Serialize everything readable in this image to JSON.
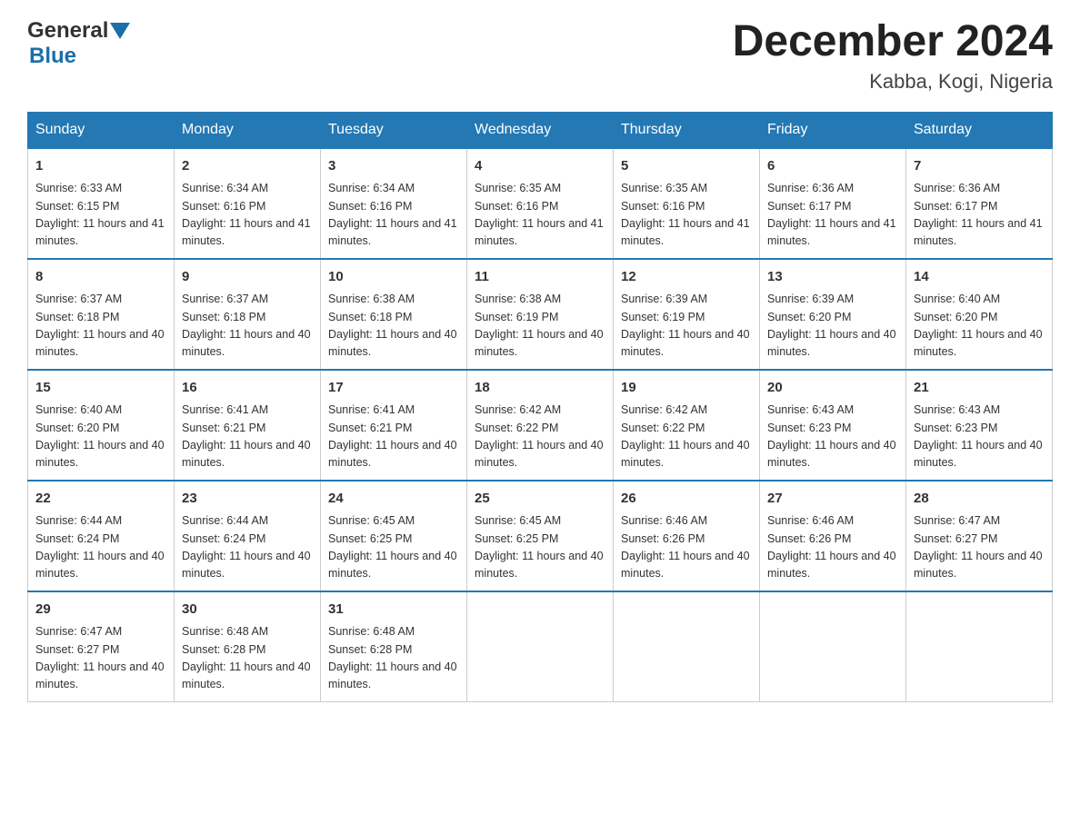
{
  "header": {
    "logo_general": "General",
    "logo_blue": "Blue",
    "title": "December 2024",
    "subtitle": "Kabba, Kogi, Nigeria"
  },
  "columns": [
    "Sunday",
    "Monday",
    "Tuesday",
    "Wednesday",
    "Thursday",
    "Friday",
    "Saturday"
  ],
  "weeks": [
    [
      {
        "day": "1",
        "sunrise": "6:33 AM",
        "sunset": "6:15 PM",
        "daylight": "11 hours and 41 minutes."
      },
      {
        "day": "2",
        "sunrise": "6:34 AM",
        "sunset": "6:16 PM",
        "daylight": "11 hours and 41 minutes."
      },
      {
        "day": "3",
        "sunrise": "6:34 AM",
        "sunset": "6:16 PM",
        "daylight": "11 hours and 41 minutes."
      },
      {
        "day": "4",
        "sunrise": "6:35 AM",
        "sunset": "6:16 PM",
        "daylight": "11 hours and 41 minutes."
      },
      {
        "day": "5",
        "sunrise": "6:35 AM",
        "sunset": "6:16 PM",
        "daylight": "11 hours and 41 minutes."
      },
      {
        "day": "6",
        "sunrise": "6:36 AM",
        "sunset": "6:17 PM",
        "daylight": "11 hours and 41 minutes."
      },
      {
        "day": "7",
        "sunrise": "6:36 AM",
        "sunset": "6:17 PM",
        "daylight": "11 hours and 41 minutes."
      }
    ],
    [
      {
        "day": "8",
        "sunrise": "6:37 AM",
        "sunset": "6:18 PM",
        "daylight": "11 hours and 40 minutes."
      },
      {
        "day": "9",
        "sunrise": "6:37 AM",
        "sunset": "6:18 PM",
        "daylight": "11 hours and 40 minutes."
      },
      {
        "day": "10",
        "sunrise": "6:38 AM",
        "sunset": "6:18 PM",
        "daylight": "11 hours and 40 minutes."
      },
      {
        "day": "11",
        "sunrise": "6:38 AM",
        "sunset": "6:19 PM",
        "daylight": "11 hours and 40 minutes."
      },
      {
        "day": "12",
        "sunrise": "6:39 AM",
        "sunset": "6:19 PM",
        "daylight": "11 hours and 40 minutes."
      },
      {
        "day": "13",
        "sunrise": "6:39 AM",
        "sunset": "6:20 PM",
        "daylight": "11 hours and 40 minutes."
      },
      {
        "day": "14",
        "sunrise": "6:40 AM",
        "sunset": "6:20 PM",
        "daylight": "11 hours and 40 minutes."
      }
    ],
    [
      {
        "day": "15",
        "sunrise": "6:40 AM",
        "sunset": "6:20 PM",
        "daylight": "11 hours and 40 minutes."
      },
      {
        "day": "16",
        "sunrise": "6:41 AM",
        "sunset": "6:21 PM",
        "daylight": "11 hours and 40 minutes."
      },
      {
        "day": "17",
        "sunrise": "6:41 AM",
        "sunset": "6:21 PM",
        "daylight": "11 hours and 40 minutes."
      },
      {
        "day": "18",
        "sunrise": "6:42 AM",
        "sunset": "6:22 PM",
        "daylight": "11 hours and 40 minutes."
      },
      {
        "day": "19",
        "sunrise": "6:42 AM",
        "sunset": "6:22 PM",
        "daylight": "11 hours and 40 minutes."
      },
      {
        "day": "20",
        "sunrise": "6:43 AM",
        "sunset": "6:23 PM",
        "daylight": "11 hours and 40 minutes."
      },
      {
        "day": "21",
        "sunrise": "6:43 AM",
        "sunset": "6:23 PM",
        "daylight": "11 hours and 40 minutes."
      }
    ],
    [
      {
        "day": "22",
        "sunrise": "6:44 AM",
        "sunset": "6:24 PM",
        "daylight": "11 hours and 40 minutes."
      },
      {
        "day": "23",
        "sunrise": "6:44 AM",
        "sunset": "6:24 PM",
        "daylight": "11 hours and 40 minutes."
      },
      {
        "day": "24",
        "sunrise": "6:45 AM",
        "sunset": "6:25 PM",
        "daylight": "11 hours and 40 minutes."
      },
      {
        "day": "25",
        "sunrise": "6:45 AM",
        "sunset": "6:25 PM",
        "daylight": "11 hours and 40 minutes."
      },
      {
        "day": "26",
        "sunrise": "6:46 AM",
        "sunset": "6:26 PM",
        "daylight": "11 hours and 40 minutes."
      },
      {
        "day": "27",
        "sunrise": "6:46 AM",
        "sunset": "6:26 PM",
        "daylight": "11 hours and 40 minutes."
      },
      {
        "day": "28",
        "sunrise": "6:47 AM",
        "sunset": "6:27 PM",
        "daylight": "11 hours and 40 minutes."
      }
    ],
    [
      {
        "day": "29",
        "sunrise": "6:47 AM",
        "sunset": "6:27 PM",
        "daylight": "11 hours and 40 minutes."
      },
      {
        "day": "30",
        "sunrise": "6:48 AM",
        "sunset": "6:28 PM",
        "daylight": "11 hours and 40 minutes."
      },
      {
        "day": "31",
        "sunrise": "6:48 AM",
        "sunset": "6:28 PM",
        "daylight": "11 hours and 40 minutes."
      },
      null,
      null,
      null,
      null
    ]
  ]
}
